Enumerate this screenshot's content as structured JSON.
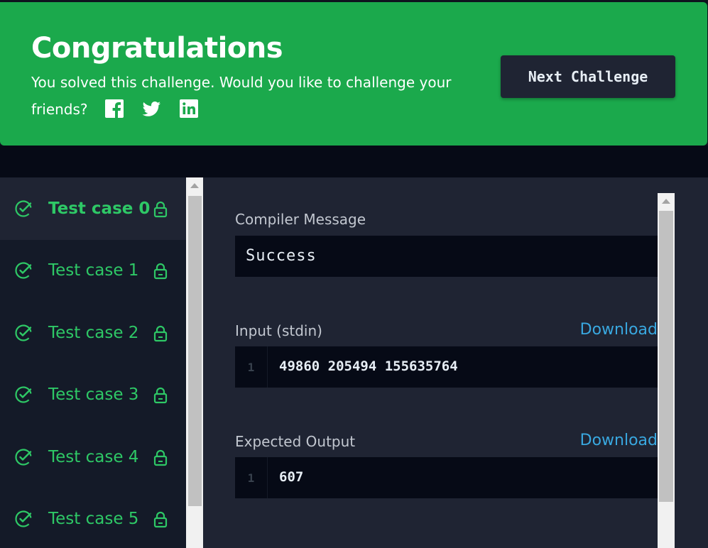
{
  "banner": {
    "title": "Congratulations",
    "message": "You solved this challenge. Would you like to challenge your friends?",
    "social": [
      "facebook-icon",
      "twitter-icon",
      "linkedin-icon"
    ],
    "next_label": "Next Challenge",
    "color": "#1ba94c"
  },
  "sidebar": {
    "items": [
      {
        "label": "Test case 0",
        "status": "passed",
        "locked": true,
        "active": true
      },
      {
        "label": "Test case 1",
        "status": "passed",
        "locked": true,
        "active": false
      },
      {
        "label": "Test case 2",
        "status": "passed",
        "locked": true,
        "active": false
      },
      {
        "label": "Test case 3",
        "status": "passed",
        "locked": true,
        "active": false
      },
      {
        "label": "Test case 4",
        "status": "passed",
        "locked": true,
        "active": false
      },
      {
        "label": "Test case 5",
        "status": "passed",
        "locked": true,
        "active": false
      }
    ]
  },
  "main": {
    "compiler_label": "Compiler Message",
    "compiler_message": "Success",
    "input_label": "Input (stdin)",
    "input_download": "Download",
    "input_line_no": "1",
    "input_value": "49860 205494 155635764",
    "output_label": "Expected Output",
    "output_download": "Download",
    "output_line_no": "1",
    "output_value": "607"
  },
  "colors": {
    "success": "#2ec866",
    "link": "#39a8e0"
  }
}
